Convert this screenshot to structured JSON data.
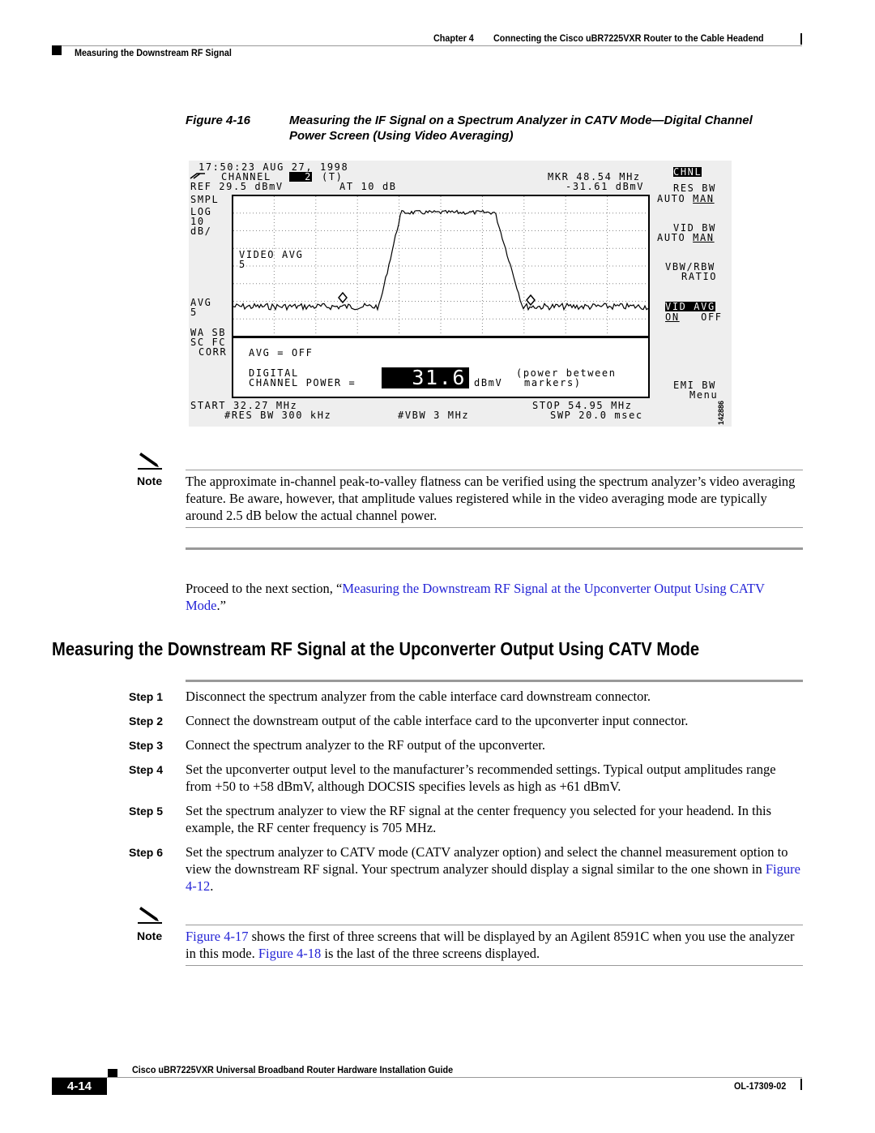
{
  "header": {
    "chapter": "Chapter 4",
    "chapter_title": "Connecting the Cisco uBR7225VXR Router to the Cable Headend",
    "section": "Measuring the Downstream RF Signal"
  },
  "figure": {
    "label": "Figure 4-16",
    "title_line1": "Measuring the IF Signal on a Spectrum Analyzer in CATV Mode—Digital Channel",
    "title_line2": "Power Screen (Using Video Averaging)",
    "screen": {
      "timestamp": "17:50:23 AUG 27, 1998",
      "channel_label": "CHANNEL",
      "channel_num": "2",
      "channel_suffix": "(T)",
      "ref": "REF 29.5 dBmV",
      "atten": "AT 10 dB",
      "mkr_freq": "MKR 48.54 MHz",
      "mkr_level": "-31.61 dBmV",
      "left": [
        "SMPL",
        "LOG",
        "10",
        "dB/"
      ],
      "avg": [
        "AVG",
        "5"
      ],
      "wa_sb": "WA SB",
      "sc_fc": "SC FC",
      "corr": "CORR",
      "video_avg": "VIDEO AVG",
      "video_avg_n": "5",
      "avg_off": "AVG = OFF",
      "digital": "DIGITAL",
      "channel_power": "CHANNEL POWER =",
      "power_value": "31.6",
      "power_unit": "dBmV",
      "power_note1": "(power between",
      "power_note2": "markers)",
      "start": "START 32.27 MHz",
      "stop": "STOP 54.95 MHz",
      "res_bw_val": "#RES BW 300 kHz",
      "vbw_val": "#VBW 3 MHz",
      "swp": "SWP 20.0 msec",
      "softkeys": {
        "chnl": "CHNL",
        "res_bw": "RES BW",
        "auto": "AUTO",
        "man": "MAN",
        "vid_bw": "VID BW",
        "vbw_rbw": "VBW/RBW",
        "ratio": "RATIO",
        "vid_avg": "VID AVG",
        "on": "ON",
        "off": "OFF",
        "emi_bw": "EMI BW",
        "menu": "Menu"
      },
      "figure_id": "142886"
    }
  },
  "note1": {
    "label": "Note",
    "text": "The approximate in-channel peak-to-valley flatness can be verified using the spectrum analyzer’s video averaging feature. Be aware, however, that amplitude values registered while in the video averaging mode are typically around 2.5 dB below the actual channel power."
  },
  "proceed": {
    "pre": "Proceed to the next section, “",
    "link": "Measuring the Downstream RF Signal at the Upconverter Output Using CATV Mode",
    "post": ".”"
  },
  "section_title": "Measuring the Downstream RF Signal at the Upconverter Output Using CATV Mode",
  "steps": [
    {
      "label": "Step 1",
      "text": "Disconnect the spectrum analyzer from the cable interface card downstream connector."
    },
    {
      "label": "Step 2",
      "text": "Connect the downstream output of the cable interface card to the upconverter input connector."
    },
    {
      "label": "Step 3",
      "text": "Connect the spectrum analyzer to the RF output of the upconverter."
    },
    {
      "label": "Step 4",
      "text": "Set the upconverter output level to the manufacturer’s recommended settings. Typical output amplitudes range from +50 to +58 dBmV, although DOCSIS specifies levels as high as +61 dBmV."
    },
    {
      "label": "Step 5",
      "text": "Set the spectrum analyzer to view the RF signal at the center frequency you selected for your headend. In this example, the RF center frequency is 705 MHz."
    },
    {
      "label": "Step 6",
      "text": "Set the spectrum analyzer to CATV mode (CATV analyzer option) and select the channel measurement option to view the downstream RF signal. Your spectrum analyzer should display a signal similar to the one shown in ",
      "link": "Figure 4-12",
      "post": "."
    }
  ],
  "note2": {
    "label": "Note",
    "link1": "Figure 4-17",
    "text1": " shows the first of three screens that will be displayed by an Agilent 8591C when you use the analyzer in this mode. ",
    "link2": "Figure 4-18",
    "text2": " is the last of the three screens displayed."
  },
  "footer": {
    "guide": "Cisco uBR7225VXR Universal Broadband Router Hardware Installation Guide",
    "page": "4-14",
    "doc": "OL-17309-02"
  },
  "colors": {
    "link": "#2323d6"
  }
}
